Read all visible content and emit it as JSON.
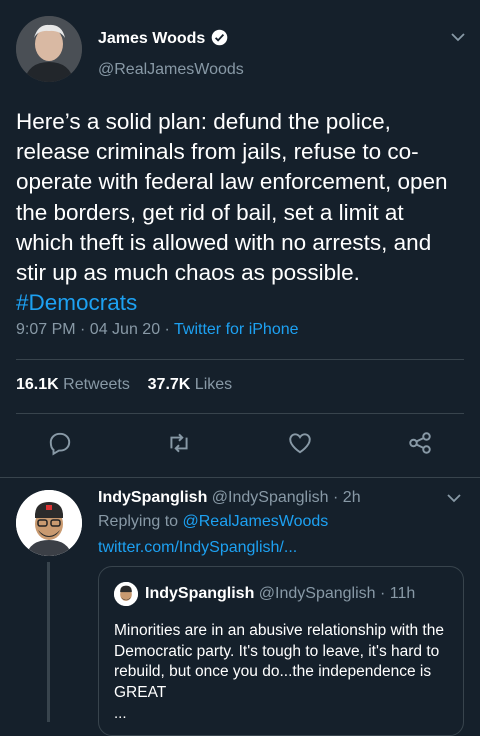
{
  "tweet": {
    "author_name": "James Woods",
    "author_handle": "@RealJamesWoods",
    "text": "Here’s a solid plan: defund the police, release criminals from jails, refuse to co-operate with federal law enforcement, open the borders, get rid of bail, set a limit at which theft is allowed with no arrests, and stir up as much chaos as possible.",
    "hashtag": "#Democrats",
    "time": "9:07 PM · 04 Jun 20 · ",
    "source": "Twitter for iPhone",
    "retweets_count": "16.1K",
    "retweets_label": "Retweets",
    "likes_count": "37.7K",
    "likes_label": "Likes"
  },
  "reply": {
    "author_name": "IndySpanglish",
    "author_handle": "@IndySpanglish",
    "time": "· 2h",
    "replying_prefix": "Replying to ",
    "replying_to": "@RealJamesWoods",
    "link": "twitter.com/IndySpanglish/...",
    "quote": {
      "author_name": "IndySpanglish",
      "author_handle": "@IndySpanglish",
      "time": "· 11h",
      "text": "Minorities are in an abusive relationship with the Democratic party. It's tough to leave, it's hard to rebuild, but once you do...the independence is GREAT",
      "ellipsis": "..."
    }
  },
  "icons": [
    "verified-icon",
    "chevron-down-icon",
    "reply-icon",
    "retweet-icon",
    "like-icon",
    "share-icon"
  ],
  "colors": {
    "background": "#15202b",
    "accent": "#1da1f2",
    "muted": "#8899a6",
    "divider": "#38444d"
  }
}
